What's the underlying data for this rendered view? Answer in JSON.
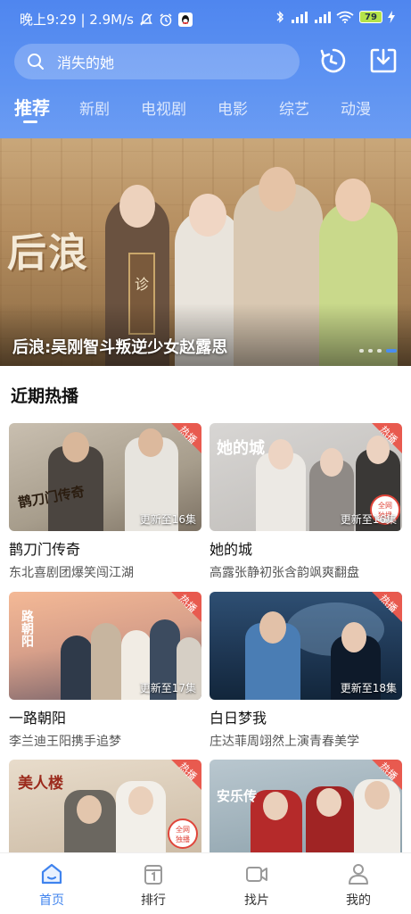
{
  "status": {
    "time_speed": "晚上9:29 | 2.9M/s",
    "battery": "79"
  },
  "search": {
    "placeholder": "消失的她"
  },
  "tabs": [
    "推荐",
    "新剧",
    "电视剧",
    "电影",
    "综艺",
    "动漫"
  ],
  "hero": {
    "calligraphy": "后浪",
    "caption": "后浪:吴刚智斗叛逆少女赵露思",
    "plaque": "诊"
  },
  "section": {
    "title": "近期热播"
  },
  "badge_label": "热播",
  "cards": [
    {
      "title": "鹊刀门传奇",
      "subtitle": "东北喜剧团爆笑闯江湖",
      "episodes": "更新至16集",
      "art": "鹊刀门传奇"
    },
    {
      "title": "她的城",
      "subtitle": "高露张静初张含韵飒爽翻盘",
      "episodes": "更新至16集",
      "art": "她的城"
    },
    {
      "title": "一路朝阳",
      "subtitle": "李兰迪王阳携手追梦",
      "episodes": "更新至17集",
      "art": "路朝阳"
    },
    {
      "title": "白日梦我",
      "subtitle": "庄达菲周翊然上演青春美学",
      "episodes": "更新至18集",
      "art": ""
    },
    {
      "title": "",
      "subtitle": "",
      "episodes": "",
      "art": "美人楼"
    },
    {
      "title": "",
      "subtitle": "",
      "episodes": "",
      "art": "安乐传"
    }
  ],
  "exclusive_label": {
    "line1": "全网",
    "line2": "独播"
  },
  "nav": [
    {
      "label": "首页",
      "icon": "home-icon",
      "active": true
    },
    {
      "label": "排行",
      "icon": "ranking-icon",
      "active": false
    },
    {
      "label": "找片",
      "icon": "video-camera-icon",
      "active": false
    },
    {
      "label": "我的",
      "icon": "profile-icon",
      "active": false
    }
  ],
  "colors": {
    "header": "#4f86ef",
    "accent": "#3f83ee",
    "badge": "#e85a4f"
  }
}
